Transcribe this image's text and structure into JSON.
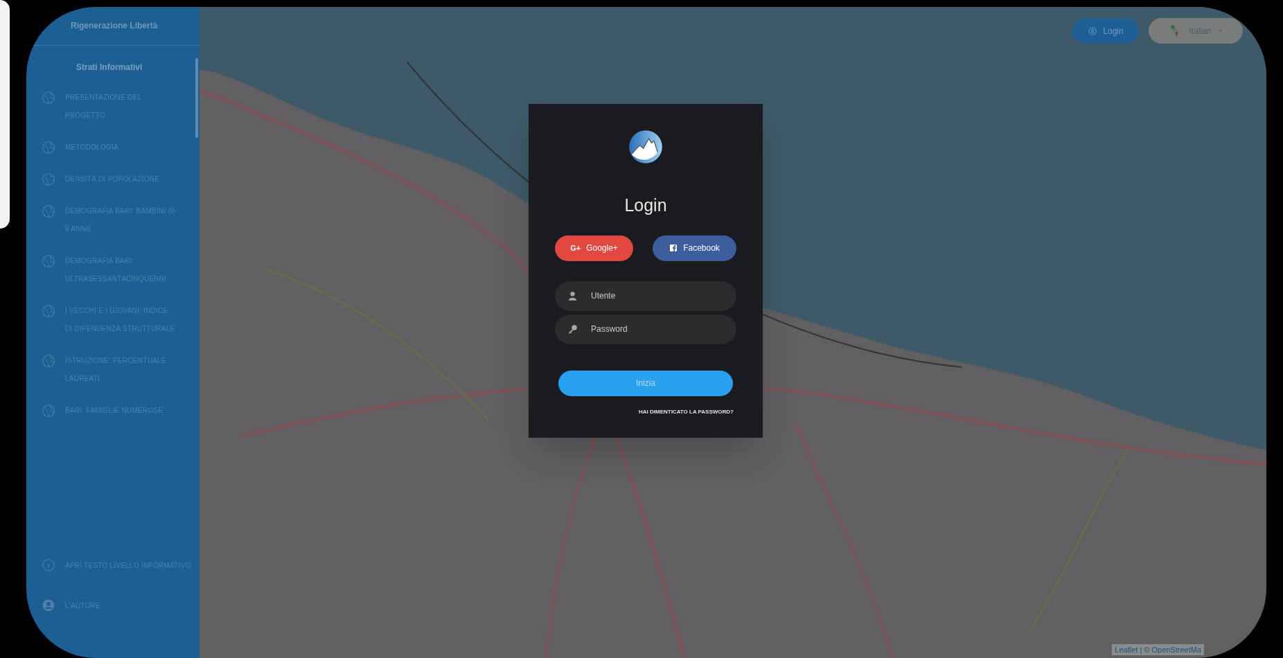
{
  "sidebar": {
    "brand": "Rigenerazione Libertà",
    "section_title": "Strati Informativi",
    "items": [
      {
        "label": "PRESENTAZIONE DEL PROGETTO"
      },
      {
        "label": "METODOLOGIA"
      },
      {
        "label": "DENSITÀ DI POPOLAZIONE"
      },
      {
        "label": "DEMOGRAFIA BARI: BAMBINI (0-9 ANNI)"
      },
      {
        "label": "DEMOGRAFIA BARI: ULTRASESSANTACINQUENNI"
      },
      {
        "label": "I VECCHI E I GIOVANI: INDICE DI DIPENDENZA STRUTTURALE"
      },
      {
        "label": "ISTRUZIONE: PERCENTUALE LAUREATI"
      },
      {
        "label": "BARI: FAMIGLIE NUMEROSE"
      }
    ],
    "footer_items": [
      {
        "kind": "info",
        "label": "APRI TESTO LIVELLO INFORMATIVO"
      },
      {
        "kind": "user",
        "label": "L'AUTORE"
      }
    ]
  },
  "header": {
    "login_button": "Login",
    "language": "Italian"
  },
  "login_modal": {
    "title": "Login",
    "social_buttons": [
      {
        "kind": "google",
        "icon_text": "G+",
        "label": "Google+"
      },
      {
        "kind": "facebook",
        "label": "Facebook"
      }
    ],
    "fields": [
      {
        "kind": "user",
        "placeholder": "Utente"
      },
      {
        "kind": "password",
        "placeholder": "Password"
      }
    ],
    "submit": "Inizia",
    "forgot_link": "HAI DIMENTICATO LA PASSWORD?"
  },
  "map": {
    "attribution": "Leaflet | © OpenStreetMa"
  }
}
